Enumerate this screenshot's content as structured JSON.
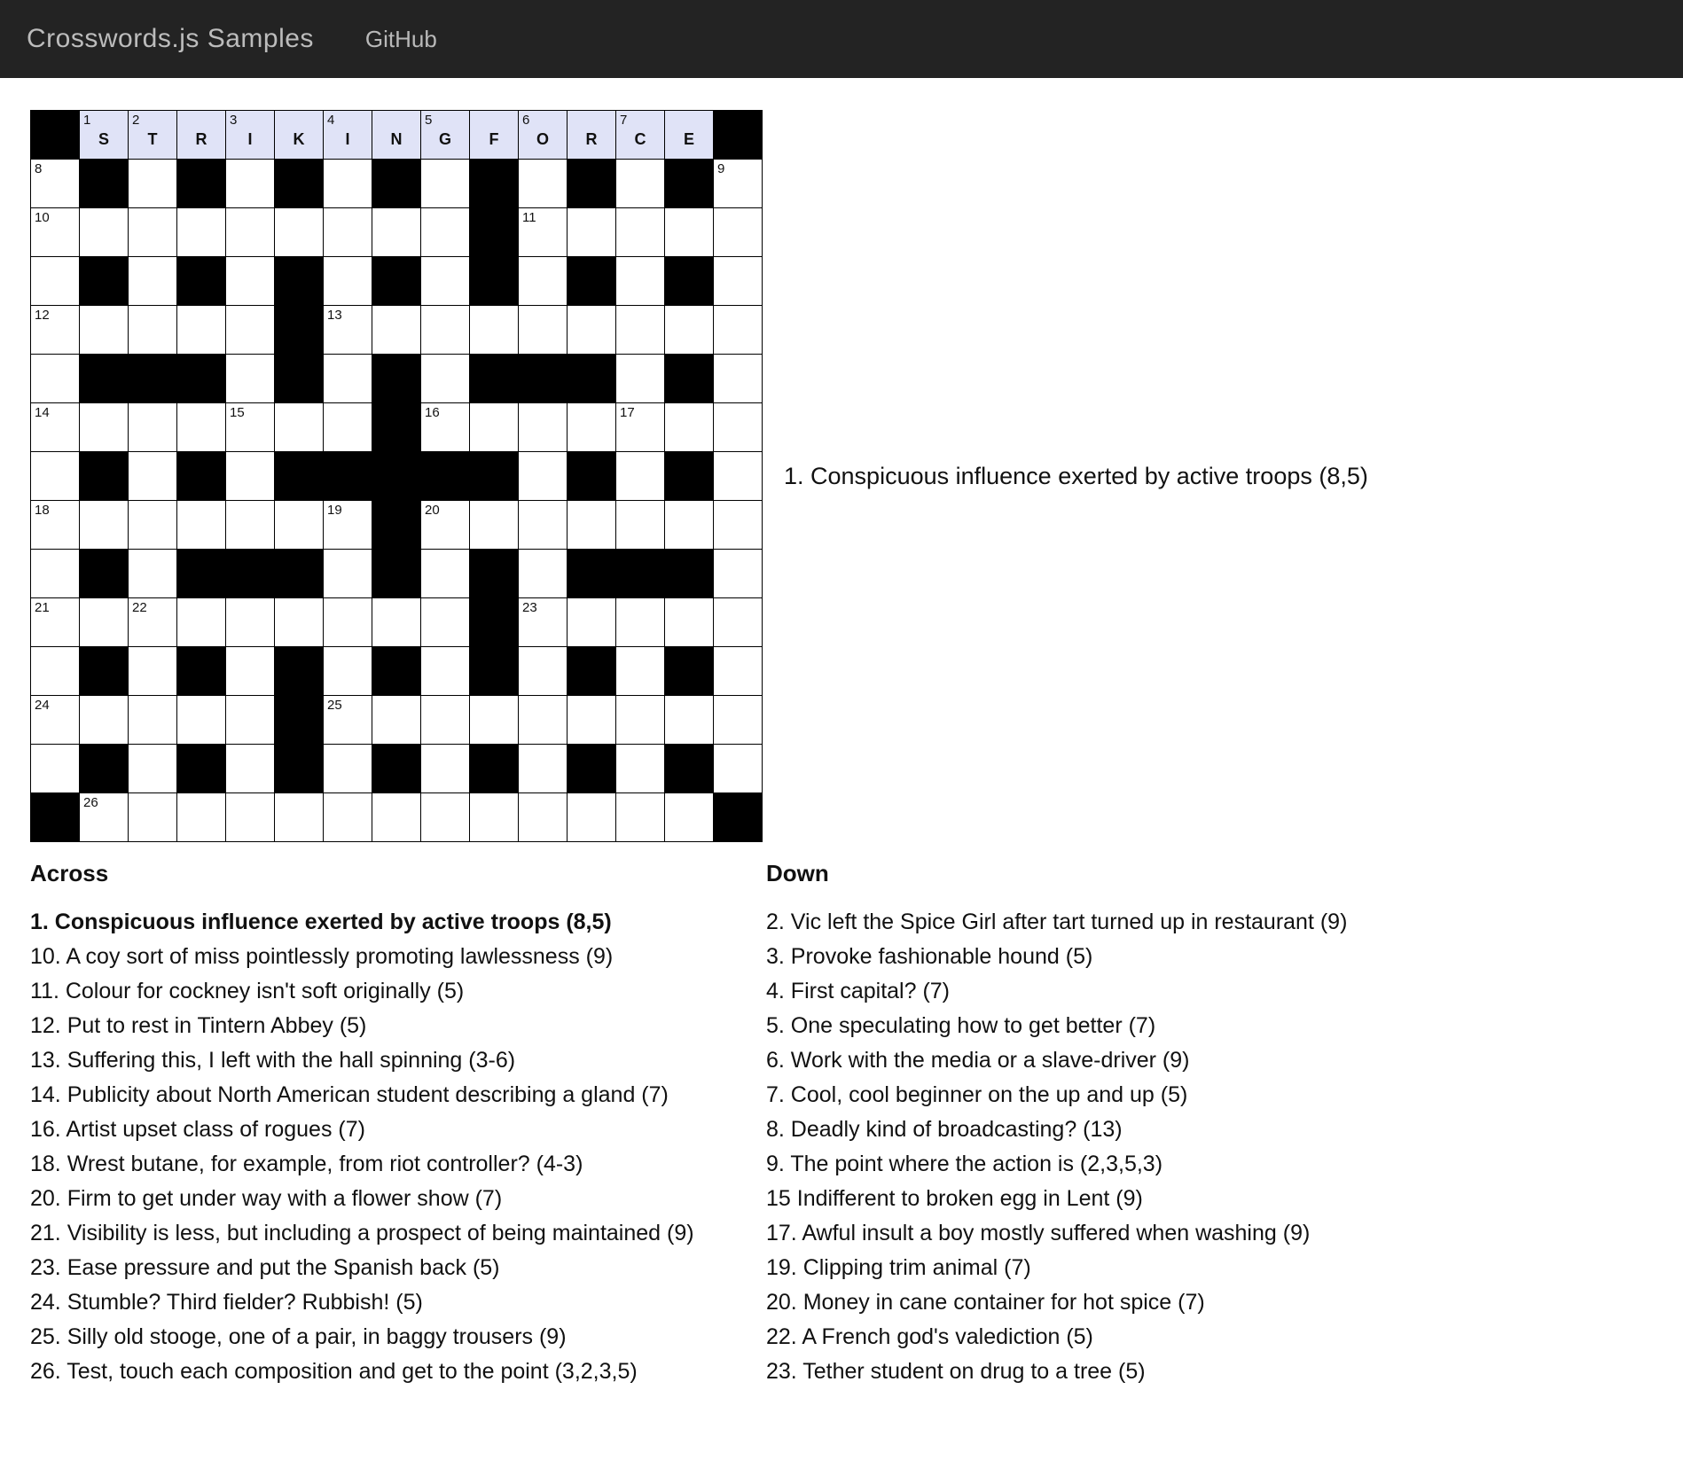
{
  "nav": {
    "title": "Crosswords.js Samples",
    "link": "GitHub"
  },
  "current_clue": "1. Conspicuous influence exerted by active troops (8,5)",
  "grid": {
    "size": 15,
    "cells": [
      [
        "B",
        {
          "n": 1,
          "l": "S",
          "hl": 1
        },
        {
          "n": 2,
          "l": "T",
          "hl": 1
        },
        {
          "l": "R",
          "hl": 1
        },
        {
          "n": 3,
          "l": "I",
          "hl": 1
        },
        {
          "l": "K",
          "hl": 1
        },
        {
          "n": 4,
          "l": "I",
          "hl": 1
        },
        {
          "l": "N",
          "hl": 1
        },
        {
          "n": 5,
          "l": "G",
          "hl": 1
        },
        {
          "l": "F",
          "hl": 1
        },
        {
          "n": 6,
          "l": "O",
          "hl": 1
        },
        {
          "l": "R",
          "hl": 1
        },
        {
          "n": 7,
          "l": "C",
          "hl": 1
        },
        {
          "l": "E",
          "hl": 1
        },
        "B"
      ],
      [
        {
          "n": 8
        },
        "B",
        {},
        "B",
        {},
        "B",
        {},
        "B",
        {},
        "B",
        {},
        "B",
        {},
        "B",
        {
          "n": 9
        }
      ],
      [
        {
          "n": 10
        },
        {},
        {},
        {},
        {},
        {},
        {},
        {},
        {},
        "B",
        {
          "n": 11
        },
        {},
        {},
        {},
        {}
      ],
      [
        {},
        "B",
        {},
        "B",
        {},
        "B",
        {},
        "B",
        {},
        "B",
        {},
        "B",
        {},
        "B",
        {}
      ],
      [
        {
          "n": 12
        },
        {},
        {},
        {},
        {},
        "B",
        {
          "n": 13
        },
        {},
        {},
        {},
        {},
        {},
        {},
        {},
        {}
      ],
      [
        {},
        "B",
        "B",
        "B",
        {},
        "B",
        {},
        "B",
        {},
        "B",
        "B",
        "B",
        {},
        "B",
        {}
      ],
      [
        {
          "n": 14
        },
        {},
        {},
        {},
        {
          "n": 15
        },
        {},
        {},
        "B",
        {
          "n": 16
        },
        {},
        {},
        {},
        {
          "n": 17
        },
        {},
        {}
      ],
      [
        {},
        "B",
        {},
        "B",
        {},
        "B",
        "B",
        "B",
        "B",
        "B",
        {},
        "B",
        {},
        "B",
        {}
      ],
      [
        {
          "n": 18
        },
        {},
        {},
        {},
        {},
        {},
        {
          "n": 19
        },
        "B",
        {
          "n": 20
        },
        {},
        {},
        {},
        {},
        {},
        {}
      ],
      [
        {},
        "B",
        {},
        "B",
        "B",
        "B",
        {},
        "B",
        {},
        "B",
        {},
        "B",
        "B",
        "B",
        {}
      ],
      [
        {
          "n": 21
        },
        {},
        {
          "n": 22
        },
        {},
        {},
        {},
        {},
        {},
        {},
        "B",
        {
          "n": 23
        },
        {},
        {},
        {},
        {}
      ],
      [
        {},
        "B",
        {},
        "B",
        {},
        "B",
        {},
        "B",
        {},
        "B",
        {},
        "B",
        {},
        "B",
        {}
      ],
      [
        {
          "n": 24
        },
        {},
        {},
        {},
        {},
        "B",
        {
          "n": 25
        },
        {},
        {},
        {},
        {},
        {},
        {},
        {},
        {}
      ],
      [
        {},
        "B",
        {},
        "B",
        {},
        "B",
        {},
        "B",
        {},
        "B",
        {},
        "B",
        {},
        "B",
        {}
      ],
      [
        "B",
        {
          "n": 26
        },
        {},
        {},
        {},
        {},
        {},
        {},
        {},
        {},
        {},
        {},
        {},
        {},
        "B"
      ]
    ]
  },
  "across_title": "Across",
  "down_title": "Down",
  "across_clues": [
    {
      "n": 1,
      "t": "Conspicuous influence exerted by active troops (8,5)",
      "sel": true
    },
    {
      "n": 10,
      "t": "A coy sort of miss pointlessly promoting lawlessness (9)"
    },
    {
      "n": 11,
      "t": "Colour for cockney isn't soft originally (5)"
    },
    {
      "n": 12,
      "t": "Put to rest in Tintern Abbey (5)"
    },
    {
      "n": 13,
      "t": "Suffering this, I left with the hall spinning (3-6)"
    },
    {
      "n": 14,
      "t": "Publicity about North American student describing a gland (7)"
    },
    {
      "n": 16,
      "t": "Artist upset class of rogues (7)"
    },
    {
      "n": 18,
      "t": "Wrest butane, for example, from riot controller? (4-3)"
    },
    {
      "n": 20,
      "t": "Firm to get under way with a flower show (7)"
    },
    {
      "n": 21,
      "t": "Visibility is less, but including a prospect of being maintained (9)"
    },
    {
      "n": 23,
      "t": "Ease pressure and put the Spanish back (5)"
    },
    {
      "n": 24,
      "t": "Stumble? Third fielder? Rubbish! (5)"
    },
    {
      "n": 25,
      "t": "Silly old stooge, one of a pair, in baggy trousers (9)"
    },
    {
      "n": 26,
      "t": "Test, touch each composition and get to the point (3,2,3,5)"
    }
  ],
  "down_clues": [
    {
      "n": 2,
      "t": "Vic left the Spice Girl after tart turned up in restaurant (9)"
    },
    {
      "n": 3,
      "t": "Provoke fashionable hound (5)"
    },
    {
      "n": 4,
      "t": "First capital? (7)"
    },
    {
      "n": 5,
      "t": "One speculating how to get better (7)"
    },
    {
      "n": 6,
      "t": "Work with the media or a slave-driver (9)"
    },
    {
      "n": 7,
      "t": "Cool, cool beginner on the up and up (5)"
    },
    {
      "n": 8,
      "t": "Deadly kind of broadcasting? (13)"
    },
    {
      "n": 9,
      "t": "The point where the action is (2,3,5,3)"
    },
    {
      "n": 15,
      "t": "15 Indifferent to broken egg in Lent (9)",
      "raw": true
    },
    {
      "n": 17,
      "t": "Awful insult a boy mostly suffered when washing (9)"
    },
    {
      "n": 19,
      "t": "Clipping trim animal (7)"
    },
    {
      "n": 20,
      "t": "Money in cane container for hot spice (7)"
    },
    {
      "n": 22,
      "t": "A French god's valediction (5)"
    },
    {
      "n": 23,
      "t": "Tether student on drug to a tree (5)"
    }
  ]
}
